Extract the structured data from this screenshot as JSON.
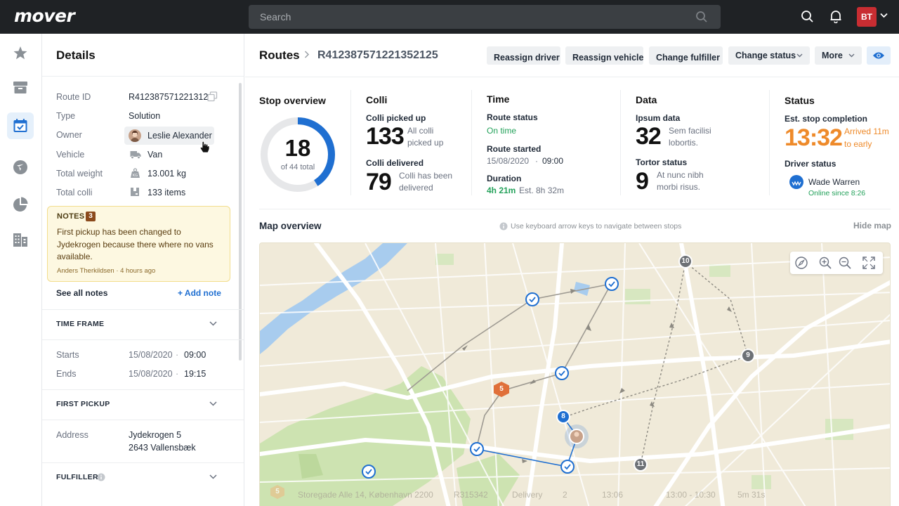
{
  "app": {
    "logo": "mover",
    "user_initials": "BT"
  },
  "search": {
    "placeholder": "Search"
  },
  "details": {
    "title": "Details",
    "fields": [
      {
        "label": "Route ID",
        "value": "R412387571221312.."
      },
      {
        "label": "Type",
        "value": "Solution"
      },
      {
        "label": "Owner",
        "value": "Leslie Alexander"
      },
      {
        "label": "Vehicle",
        "value": "Van"
      },
      {
        "label": "Total weight",
        "value": "13.001 kg"
      },
      {
        "label": "Total colli",
        "value": "133 items"
      }
    ],
    "notes": {
      "title": "NOTES",
      "count": "3",
      "text": "First pickup has been changed to Jydekrogen because there where no vans available.",
      "author": "Anders Therkildsen",
      "time": "4 hours ago"
    },
    "see_all_notes": "See all notes",
    "add_note": "+ Add note",
    "time_frame": {
      "title": "TIME FRAME",
      "starts_label": "Starts",
      "starts_date": "15/08/2020",
      "starts_time": "09:00",
      "ends_label": "Ends",
      "ends_date": "15/08/2020",
      "ends_time": "19:15"
    },
    "first_pickup": {
      "title": "FIRST PICKUP",
      "address_label": "Address",
      "address_line1": "Jydekrogen 5",
      "address_line2": "2643 Vallensbæk"
    },
    "fulfiller": {
      "title": "FULFILLER"
    }
  },
  "header": {
    "crumb_root": "Routes",
    "route_id": "R412387571221352125",
    "buttons": {
      "reassign_driver": "Reassign driver",
      "reassign_vehicle": "Reassign vehicle",
      "change_fulfiller": "Change fulfiller",
      "change_status": "Change status",
      "more": "More"
    }
  },
  "overview": {
    "stop": {
      "title": "Stop overview",
      "count": "18",
      "total": "of 44 total",
      "done": 18,
      "of": 44
    },
    "colli": {
      "title": "Colli",
      "picked_label": "Colli picked up",
      "picked_value": "133",
      "picked_desc1": "All colli",
      "picked_desc2": "picked up",
      "delivered_label": "Colli delivered",
      "delivered_value": "79",
      "delivered_desc1": "Colli has been",
      "delivered_desc2": "delivered"
    },
    "time": {
      "title": "Time",
      "status_label": "Route status",
      "status_value": "On time",
      "started_label": "Route started",
      "started_date": "15/08/2020",
      "started_time": "09:00",
      "duration_label": "Duration",
      "duration_value": "4h 21m",
      "duration_est": "Est. 8h 32m"
    },
    "data": {
      "title": "Data",
      "ipsum_label": "Ipsum data",
      "ipsum_value": "32",
      "ipsum_desc1": "Sem facilisi",
      "ipsum_desc2": "lobortis.",
      "tortor_label": "Tortor status",
      "tortor_value": "9",
      "tortor_desc1": "At nunc nibh",
      "tortor_desc2": "morbi risus."
    },
    "status": {
      "title": "Status",
      "est_label": "Est. stop completion",
      "est_time": "13:32",
      "est_desc1": "Arrived 11m",
      "est_desc2": "to early",
      "driver_label": "Driver status",
      "driver_name": "Wade Warren",
      "driver_online": "Online since 8:26"
    }
  },
  "map": {
    "title": "Map overview",
    "hint": "Use keyboard arrow keys to navigate between stops",
    "hide": "Hide map",
    "stops": [
      {
        "label": "10",
        "kind": "grey"
      },
      {
        "label": "9",
        "kind": "grey"
      },
      {
        "label": "11",
        "kind": "grey"
      },
      {
        "label": "8",
        "kind": "blue"
      },
      {
        "label": "5",
        "kind": "orange"
      }
    ],
    "row": {
      "stop": "5",
      "address": "Storegade Alle 14, København 2200",
      "route": "R315342",
      "type": "Delivery",
      "colli": "2",
      "time": "13:06",
      "window": "13:00 - 10:30",
      "duration": "5m 31s"
    }
  },
  "colors": {
    "accent": "#1f6fd1",
    "green": "#23a15a",
    "orange": "#ee8a2a",
    "brand_red": "#c82d32"
  }
}
